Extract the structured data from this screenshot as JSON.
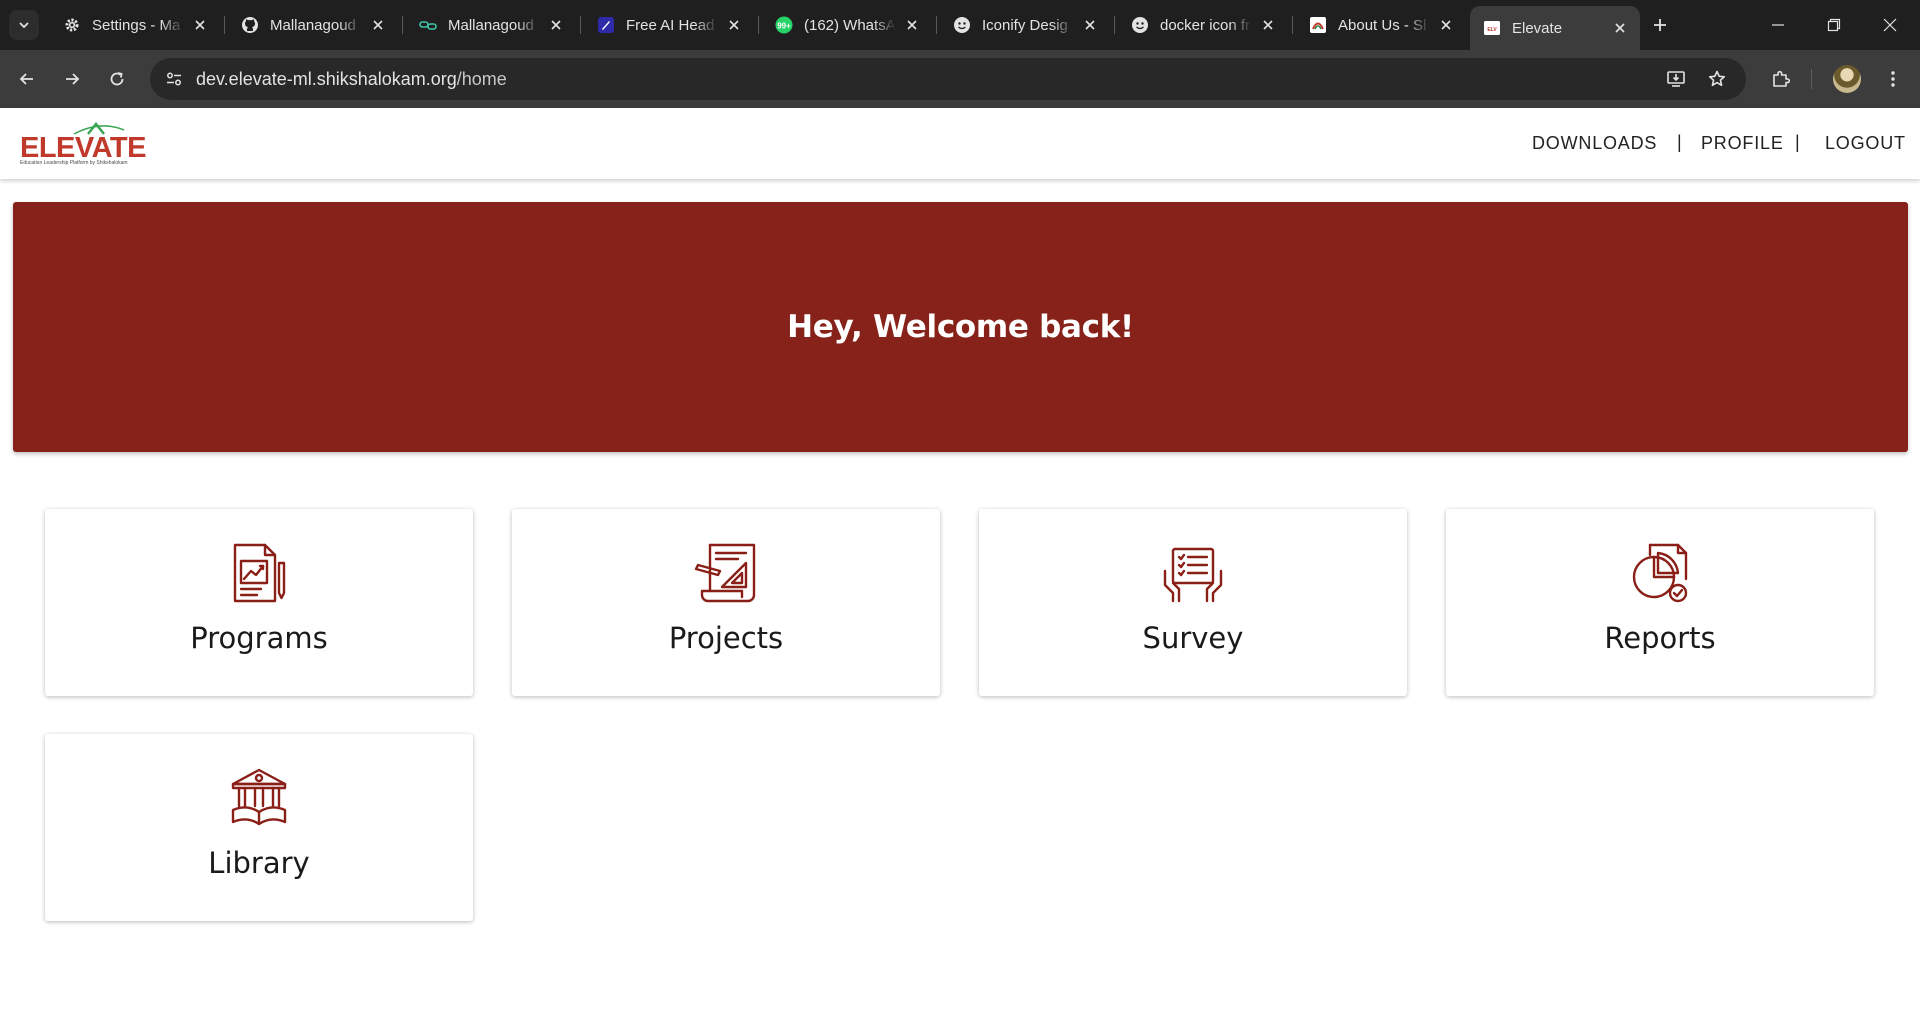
{
  "browser": {
    "tabs": [
      {
        "title": "Settings - Ma",
        "icon": "gear-icon"
      },
      {
        "title": "Mallanagoud",
        "icon": "github-icon"
      },
      {
        "title": "Mallanagoud",
        "icon": "link-icon"
      },
      {
        "title": "Free AI Head",
        "icon": "ai-headshot-icon"
      },
      {
        "title": "(162) WhatsA",
        "icon": "whatsapp-icon"
      },
      {
        "title": "Iconify Desig",
        "icon": "iconify-icon"
      },
      {
        "title": "docker icon fr",
        "icon": "iconify-icon"
      },
      {
        "title": "About Us - Sl",
        "icon": "shikshalokam-icon"
      },
      {
        "title": "Elevate",
        "icon": "elevate-icon",
        "active": true
      }
    ],
    "url_host": "dev.elevate-ml.shikshalokam.org",
    "url_path": "/home"
  },
  "header": {
    "logo_text": "ELEVATE",
    "logo_tagline": "Education Leadership Platform by Shikshalokam",
    "nav": {
      "downloads": "DOWNLOADS",
      "profile": "PROFILE",
      "logout": "LOGOUT",
      "separator": "|"
    }
  },
  "hero": {
    "greeting": "Hey, Welcome back!"
  },
  "cards": [
    {
      "label": "Programs",
      "icon": "programs-icon"
    },
    {
      "label": "Projects",
      "icon": "projects-icon"
    },
    {
      "label": "Survey",
      "icon": "survey-icon"
    },
    {
      "label": "Reports",
      "icon": "reports-icon"
    },
    {
      "label": "Library",
      "icon": "library-icon"
    }
  ],
  "colors": {
    "brand": "#862219",
    "icon": "#8a1f17",
    "chrome_dark": "#1f1f1f",
    "chrome_toolbar": "#3c3c3c"
  }
}
